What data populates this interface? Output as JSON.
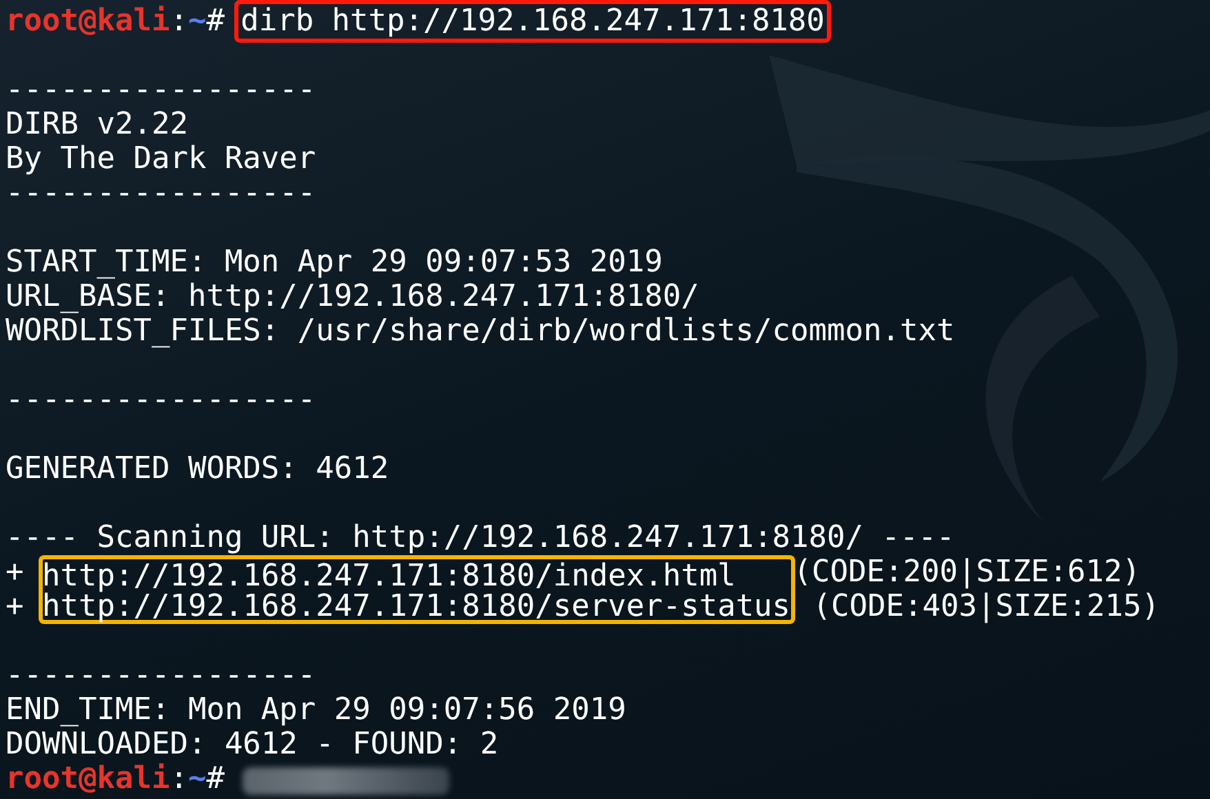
{
  "terminal": {
    "lines": [
      {
        "kind": "prompt",
        "user": "root@kali",
        "separator": ":",
        "path": "~",
        "symbol": "#",
        "command": "dirb http://192.168.247.171:8180",
        "boxed": true
      },
      {
        "kind": "blank"
      },
      {
        "kind": "text",
        "text": "-----------------"
      },
      {
        "kind": "text",
        "text": "DIRB v2.22"
      },
      {
        "kind": "text",
        "text": "By The Dark Raver"
      },
      {
        "kind": "text",
        "text": "-----------------"
      },
      {
        "kind": "blank"
      },
      {
        "kind": "text",
        "text": "START_TIME: Mon Apr 29 09:07:53 2019"
      },
      {
        "kind": "text",
        "text": "URL_BASE: http://192.168.247.171:8180/"
      },
      {
        "kind": "text",
        "text": "WORDLIST_FILES: /usr/share/dirb/wordlists/common.txt"
      },
      {
        "kind": "blank"
      },
      {
        "kind": "text",
        "text": "-----------------"
      },
      {
        "kind": "blank"
      },
      {
        "kind": "text",
        "text": "GENERATED WORDS: 4612"
      },
      {
        "kind": "blank"
      },
      {
        "kind": "text",
        "text": "---- Scanning URL: http://192.168.247.171:8180/ ----"
      },
      {
        "kind": "result",
        "prefix": "+",
        "url": "http://192.168.247.171:8180/index.html",
        "detail": "(CODE:200|SIZE:612)",
        "boxed": true
      },
      {
        "kind": "result",
        "prefix": "+",
        "url": "http://192.168.247.171:8180/server-status",
        "detail": "(CODE:403|SIZE:215)",
        "boxed": true
      },
      {
        "kind": "blank"
      },
      {
        "kind": "text",
        "text": "-----------------"
      },
      {
        "kind": "text",
        "text": "END_TIME: Mon Apr 29 09:07:56 2019"
      },
      {
        "kind": "text",
        "text": "DOWNLOADED: 4612 - FOUND: 2"
      },
      {
        "kind": "prompt",
        "user": "root@kali",
        "separator": ":",
        "path": "~",
        "symbol": "#",
        "redacted": true
      }
    ]
  }
}
